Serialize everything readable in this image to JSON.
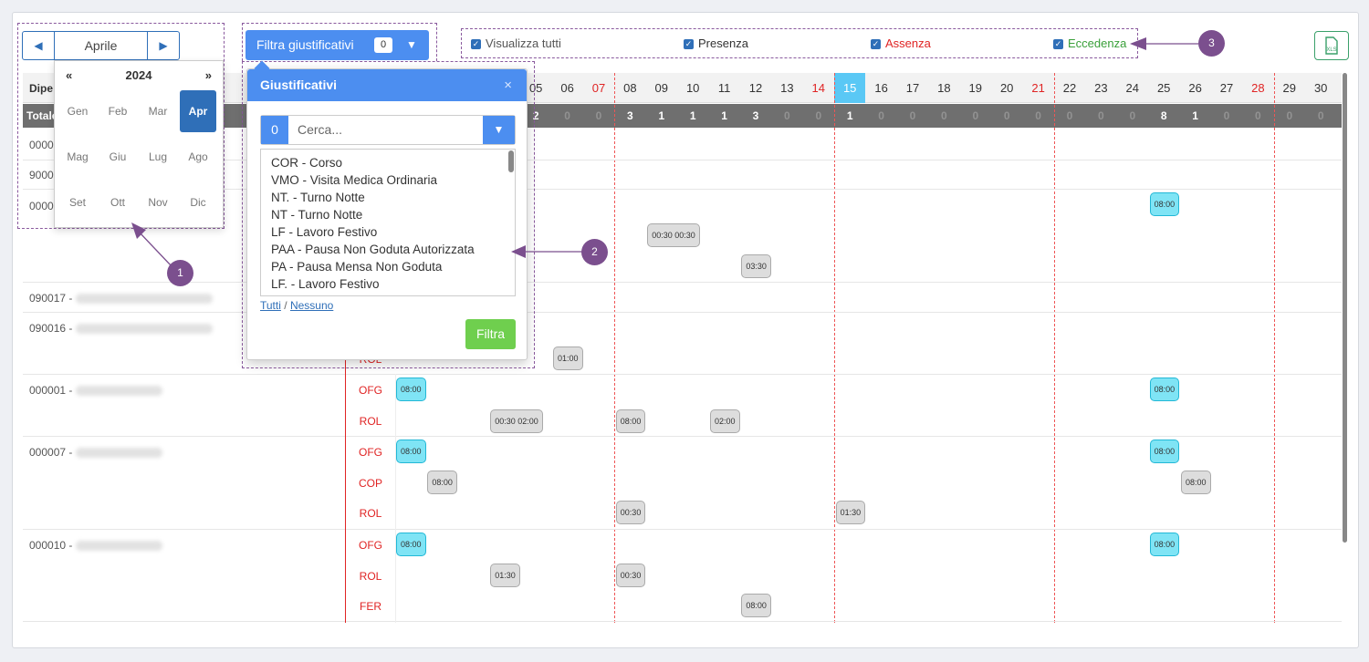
{
  "month_nav": {
    "prev_icon": "◀",
    "label": "Aprile",
    "next_icon": "▶"
  },
  "picker": {
    "prev": "«",
    "year": "2024",
    "next": "»",
    "months": [
      "Gen",
      "Feb",
      "Mar",
      "Apr",
      "Mag",
      "Giu",
      "Lug",
      "Ago",
      "Set",
      "Ott",
      "Nov",
      "Dic"
    ],
    "selected": "Apr"
  },
  "filter_button": {
    "label": "Filtra giustificativi",
    "count": "0"
  },
  "popover": {
    "title": "Giustificativi",
    "close_icon": "×",
    "search_count": "0",
    "search_placeholder": "Cerca...",
    "items": [
      "COR - Corso",
      "VMO - Visita Medica Ordinaria",
      "NT. - Turno Notte",
      "NT - Turno Notte",
      "LF - Lavoro Festivo",
      "PAA - Pausa Non Goduta Autorizzata",
      "PA - Pausa Mensa Non Goduta",
      "LF. - Lavoro Festivo"
    ],
    "link_all": "Tutti",
    "link_sep": "/",
    "link_none": "Nessuno",
    "apply": "Filtra"
  },
  "checks": [
    {
      "label": "Visualizza tutti",
      "color": "#555555"
    },
    {
      "label": "Presenza",
      "color": "#333333"
    },
    {
      "label": "Assenza",
      "color": "#e02424"
    },
    {
      "label": "Eccedenza",
      "color": "#3aa03a"
    }
  ],
  "callouts": [
    "1",
    "2",
    "3"
  ],
  "grid": {
    "header_label": "Dipe",
    "total_label": "Totale",
    "days": [
      "05",
      "06",
      "07",
      "08",
      "09",
      "10",
      "11",
      "12",
      "13",
      "14",
      "15",
      "16",
      "17",
      "18",
      "19",
      "20",
      "21",
      "22",
      "23",
      "24",
      "25",
      "26",
      "27",
      "28",
      "29",
      "30"
    ],
    "red_days": [
      "07",
      "14",
      "21",
      "28"
    ],
    "today": "15",
    "totals": [
      "2",
      "0",
      "0",
      "3",
      "1",
      "1",
      "1",
      "3",
      "0",
      "0",
      "1",
      "0",
      "0",
      "0",
      "0",
      "0",
      "0",
      "0",
      "0",
      "0",
      "8",
      "1",
      "0",
      "0",
      "0",
      "0"
    ],
    "employees": [
      {
        "id": "0000"
      },
      {
        "id": "9000"
      },
      {
        "id": "0000"
      },
      {
        "id": "090017 -"
      },
      {
        "id": "090016 -",
        "codes": [
          "ROL"
        ]
      },
      {
        "id": "000001 -",
        "codes": [
          "OFG",
          "ROL"
        ]
      },
      {
        "id": "000007 -",
        "codes": [
          "OFG",
          "COP",
          "ROL"
        ]
      },
      {
        "id": "000010 -",
        "codes": [
          "OFG",
          "ROL",
          "FER"
        ]
      }
    ],
    "badges": [
      {
        "text": "08:00",
        "day": "25",
        "row": "r2a",
        "kind": "cyan"
      },
      {
        "text": "00:30  00:30",
        "day": "09",
        "row": "r2b",
        "kind": "gray"
      },
      {
        "text": "03:30",
        "day": "12",
        "row": "r2c",
        "kind": "gray"
      },
      {
        "text": "01:00",
        "day": "06",
        "row": "r4",
        "kind": "gray"
      },
      {
        "text": "08:00",
        "day": "01",
        "row": "r5a",
        "kind": "cyan"
      },
      {
        "text": "08:00",
        "day": "25",
        "row": "r5a",
        "kind": "cyan"
      },
      {
        "text": "00:30  02:00",
        "day": "04",
        "row": "r5b",
        "kind": "gray"
      },
      {
        "text": "08:00",
        "day": "08",
        "row": "r5b",
        "kind": "gray"
      },
      {
        "text": "02:00",
        "day": "11",
        "row": "r5b",
        "kind": "gray"
      },
      {
        "text": "08:00",
        "day": "01",
        "row": "r6a",
        "kind": "cyan"
      },
      {
        "text": "08:00",
        "day": "25",
        "row": "r6a",
        "kind": "cyan"
      },
      {
        "text": "08:00",
        "day": "02",
        "row": "r6b",
        "kind": "gray"
      },
      {
        "text": "08:00",
        "day": "26",
        "row": "r6b",
        "kind": "gray"
      },
      {
        "text": "00:30",
        "day": "08",
        "row": "r6c",
        "kind": "gray"
      },
      {
        "text": "01:30",
        "day": "15",
        "row": "r6c",
        "kind": "gray"
      },
      {
        "text": "08:00",
        "day": "01",
        "row": "r7a",
        "kind": "cyan"
      },
      {
        "text": "08:00",
        "day": "25",
        "row": "r7a",
        "kind": "cyan"
      },
      {
        "text": "01:30",
        "day": "04",
        "row": "r7b",
        "kind": "gray"
      },
      {
        "text": "00:30",
        "day": "08",
        "row": "r7b",
        "kind": "gray"
      },
      {
        "text": "08:00",
        "day": "12",
        "row": "r7c",
        "kind": "gray"
      }
    ]
  }
}
